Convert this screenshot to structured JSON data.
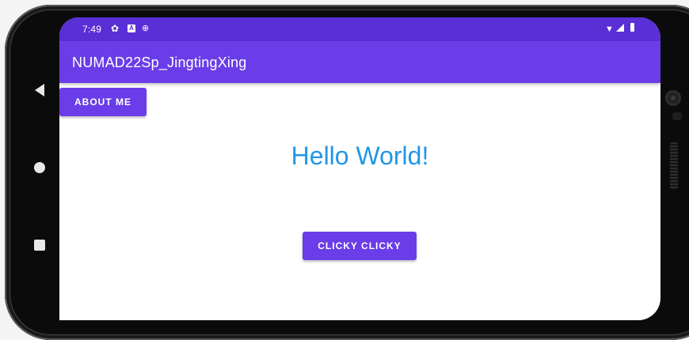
{
  "status_bar": {
    "time": "7:49",
    "icons": [
      "gear-icon",
      "a-icon",
      "mic-icon",
      "wifi-icon",
      "signal-icon",
      "battery-icon"
    ]
  },
  "app_bar": {
    "title": "NUMAD22Sp_JingtingXing"
  },
  "main": {
    "about_button_label": "ABOUT ME",
    "hello_text": "Hello World!",
    "clicky_button_label": "CLICKY CLICKY"
  },
  "nav": {
    "icons": [
      "back-icon",
      "home-icon",
      "recents-icon"
    ]
  },
  "colors": {
    "status_bar": "#5a2fd6",
    "app_bar": "#6a3de8",
    "button": "#6a3de8",
    "hello_text": "#2196e6"
  }
}
